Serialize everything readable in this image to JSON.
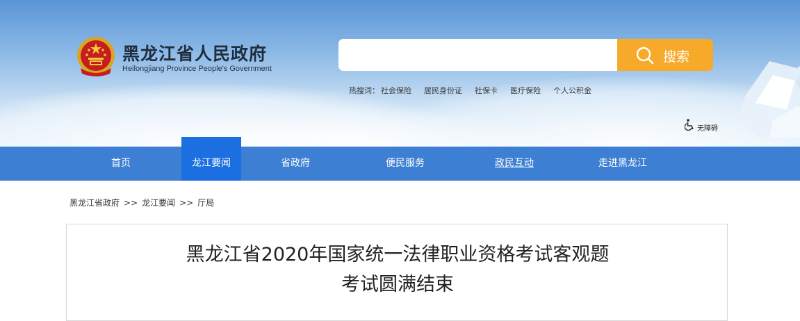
{
  "header": {
    "site_title": "黑龙江省人民政府",
    "site_subtitle": "Heilongjiang Province People's Government",
    "search": {
      "placeholder": "",
      "value": "",
      "button_label": "搜索",
      "button_color": "#f7a92a"
    },
    "hotwords": {
      "prefix": "热搜词：",
      "items": [
        "社会保险",
        "居民身份证",
        "社保卡",
        "医疗保险",
        "个人公积金"
      ]
    },
    "accessibility_label": "无障碍",
    "icons": {
      "emblem": "national-emblem-icon",
      "search": "search-icon",
      "accessibility": "wheelchair-icon"
    }
  },
  "nav": {
    "items": [
      {
        "label": "首页",
        "active": false
      },
      {
        "label": "龙江要闻",
        "active": true
      },
      {
        "label": "省政府",
        "active": false
      },
      {
        "label": "便民服务",
        "active": false
      },
      {
        "label": "政民互动",
        "active": false
      },
      {
        "label": "走进黑龙江",
        "active": false
      }
    ],
    "bar_color": "#3d7fd2",
    "active_color": "#1b6fe0"
  },
  "breadcrumb": {
    "items": [
      "黑龙江省政府",
      "龙江要闻",
      "厅局"
    ],
    "separator": ">>"
  },
  "article": {
    "title": "黑龙江省2020年国家统一法律职业资格考试客观题考试圆满结束"
  }
}
